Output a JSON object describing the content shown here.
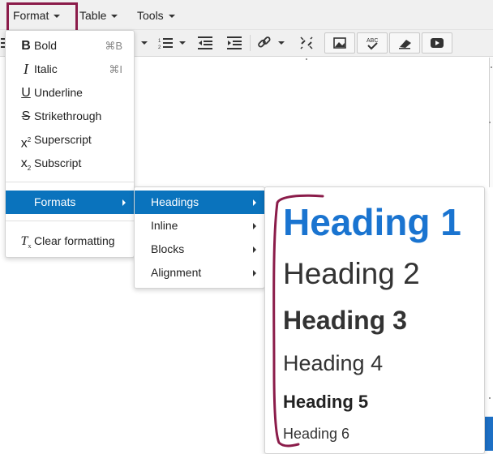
{
  "menubar": {
    "format": "Format",
    "table": "Table",
    "tools": "Tools"
  },
  "format_menu": {
    "items": [
      {
        "label": "Bold",
        "shortcut": "⌘B",
        "icon": "bold-icon"
      },
      {
        "label": "Italic",
        "shortcut": "⌘I",
        "icon": "italic-icon"
      },
      {
        "label": "Underline",
        "icon": "underline-icon"
      },
      {
        "label": "Strikethrough",
        "icon": "strikethrough-icon"
      },
      {
        "label": "Superscript",
        "icon": "superscript-icon"
      },
      {
        "label": "Subscript",
        "icon": "subscript-icon"
      }
    ],
    "formats": "Formats",
    "clear": "Clear formatting"
  },
  "formats_menu": {
    "items": [
      "Headings",
      "Inline",
      "Blocks",
      "Alignment"
    ]
  },
  "headings_menu": {
    "items": [
      "Heading 1",
      "Heading 2",
      "Heading 3",
      "Heading 4",
      "Heading 5",
      "Heading 6"
    ]
  },
  "colors": {
    "accent": "#0a73bd",
    "heading1": "#1a74d0",
    "highlight": "#8b1c4a"
  }
}
